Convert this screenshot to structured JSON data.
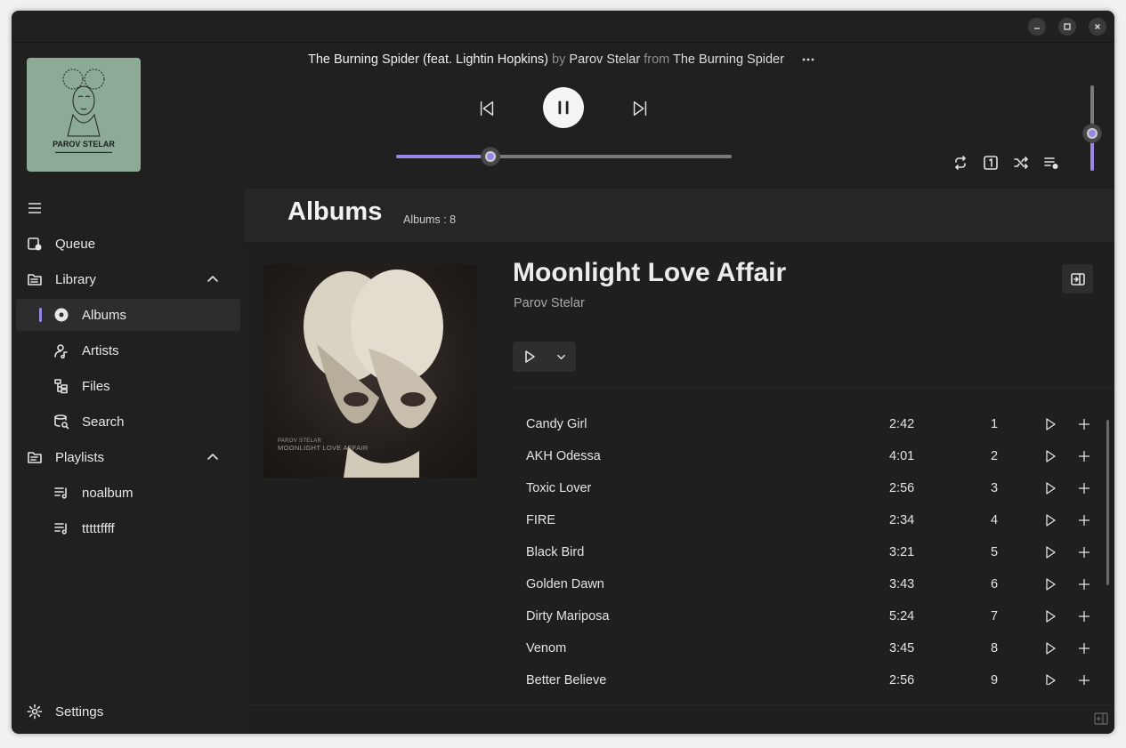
{
  "window": {
    "controls": [
      "minimize",
      "maximize",
      "close"
    ]
  },
  "now_playing": {
    "title": "The Burning Spider (feat. Lightin Hopkins)",
    "by_label": "by",
    "artist": "Parov Stelar",
    "from_label": "from",
    "album": "The Burning Spider",
    "cover_artist": "PAROV STELAR",
    "progress_fraction": 0.28,
    "volume_fraction": 0.44,
    "is_playing": true
  },
  "sidebar": {
    "menu_icon": "hamburger-icon",
    "queue_label": "Queue",
    "library_label": "Library",
    "library_items": [
      {
        "label": "Albums",
        "icon": "disc-icon",
        "active": true
      },
      {
        "label": "Artists",
        "icon": "artist-icon"
      },
      {
        "label": "Files",
        "icon": "files-icon"
      },
      {
        "label": "Search",
        "icon": "search-icon"
      }
    ],
    "playlists_label": "Playlists",
    "playlists": [
      {
        "label": "noalbum",
        "icon": "playlist-icon"
      },
      {
        "label": "tttttffff",
        "icon": "playlist-icon"
      }
    ],
    "settings_label": "Settings"
  },
  "main": {
    "page_title": "Albums",
    "count_label": "Albums :  8",
    "album": {
      "title": "Moonlight Love Affair",
      "artist": "Parov Stelar",
      "cover_caption_line1": "PAROV STELAR",
      "cover_caption_line2": "MOONLIGHT LOVE AFFAIR"
    },
    "tracks": [
      {
        "name": "Candy Girl",
        "duration": "2:42",
        "number": "1"
      },
      {
        "name": "AKH Odessa",
        "duration": "4:01",
        "number": "2"
      },
      {
        "name": "Toxic Lover",
        "duration": "2:56",
        "number": "3"
      },
      {
        "name": "FIRE",
        "duration": "2:34",
        "number": "4"
      },
      {
        "name": "Black Bird",
        "duration": "3:21",
        "number": "5"
      },
      {
        "name": "Golden Dawn",
        "duration": "3:43",
        "number": "6"
      },
      {
        "name": "Dirty Mariposa",
        "duration": "5:24",
        "number": "7"
      },
      {
        "name": "Venom",
        "duration": "3:45",
        "number": "8"
      },
      {
        "name": "Better Believe",
        "duration": "2:56",
        "number": "9"
      }
    ]
  },
  "colors": {
    "accent": "#9a86e6",
    "background": "#202020",
    "panel": "#262626"
  }
}
